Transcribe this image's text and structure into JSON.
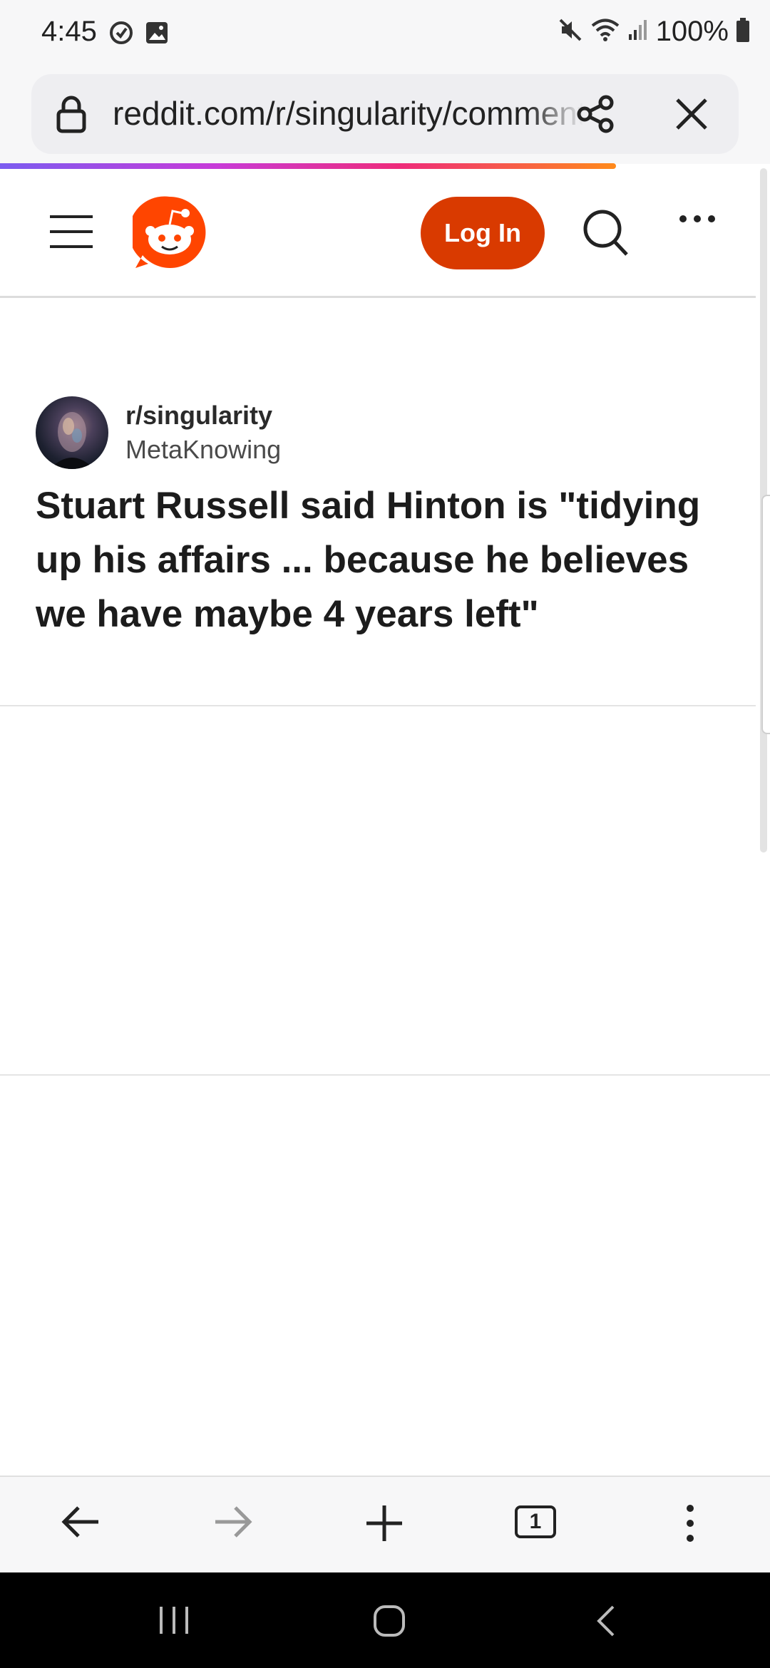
{
  "status_bar": {
    "time": "4:45",
    "battery": "100%",
    "icons": [
      "sync-icon",
      "image-icon",
      "mute-icon",
      "wifi-icon",
      "signal-icon",
      "battery-icon"
    ]
  },
  "browser": {
    "url": "reddit.com/r/singularity/comments",
    "progress_colors": [
      "#7b5cf0",
      "#c73ad8",
      "#ee2b7a",
      "#ff8a1a"
    ],
    "toolbar": {
      "tab_count": "1"
    }
  },
  "reddit": {
    "brand_color": "#ff4500",
    "login_color": "#d93a00",
    "header": {
      "login_label": "Log In"
    },
    "post": {
      "subreddit": "r/singularity",
      "author": "MetaKnowing",
      "title": "Stuart Russell said Hinton is \"tidying up his affairs ... because he believes we have maybe 4 years left\""
    }
  }
}
